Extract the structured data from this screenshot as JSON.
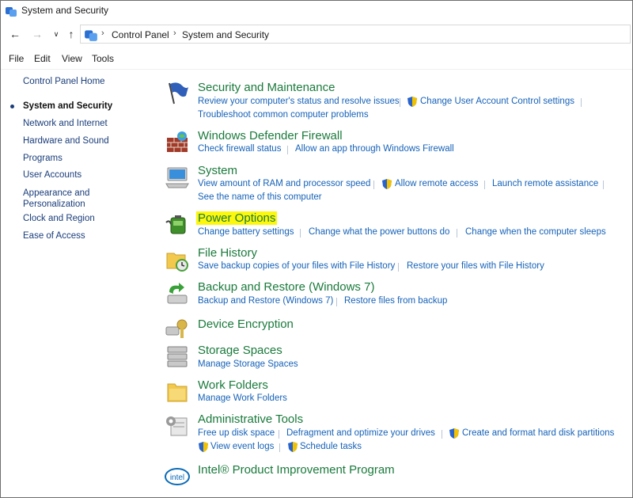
{
  "window": {
    "title": "System and Security"
  },
  "address": {
    "segments": [
      "Control Panel",
      "System and Security"
    ]
  },
  "menu": [
    "File",
    "Edit",
    "View",
    "Tools"
  ],
  "sidebar": {
    "home": "Control Panel Home",
    "items": [
      {
        "label": "System and Security",
        "current": true
      },
      {
        "label": "Network and Internet"
      },
      {
        "label": "Hardware and Sound"
      },
      {
        "label": "Programs"
      },
      {
        "label": "User Accounts"
      },
      {
        "label": "Appearance and Personalization"
      },
      {
        "label": "Clock and Region"
      },
      {
        "label": "Ease of Access"
      }
    ]
  },
  "categories": {
    "security": {
      "title": "Security and Maintenance",
      "icon": "flag-icon",
      "links": [
        "Review your computer's status and resolve issues",
        "Change User Account Control settings",
        "Troubleshoot common computer problems"
      ]
    },
    "firewall": {
      "title": "Windows Defender Firewall",
      "icon": "brick-wall-icon",
      "links": [
        "Check firewall status",
        "Allow an app through Windows Firewall"
      ]
    },
    "system": {
      "title": "System",
      "icon": "computer-icon",
      "links": [
        "View amount of RAM and processor speed",
        "Allow remote access",
        "Launch remote assistance",
        "See the name of this computer"
      ]
    },
    "power": {
      "title": "Power Options",
      "icon": "battery-icon",
      "highlighted": true,
      "links": [
        "Change battery settings",
        "Change what the power buttons do",
        "Change when the computer sleeps"
      ]
    },
    "filehistory": {
      "title": "File History",
      "icon": "folder-clock-icon",
      "links": [
        "Save backup copies of your files with File History",
        "Restore your files with File History"
      ]
    },
    "backup": {
      "title": "Backup and Restore (Windows 7)",
      "icon": "backup-icon",
      "links": [
        "Backup and Restore (Windows 7)",
        "Restore files from backup"
      ]
    },
    "encryption": {
      "title": "Device Encryption",
      "icon": "key-icon",
      "links": []
    },
    "storage": {
      "title": "Storage Spaces",
      "icon": "disks-icon",
      "links": [
        "Manage Storage Spaces"
      ]
    },
    "workfolders": {
      "title": "Work Folders",
      "icon": "folder-icon",
      "links": [
        "Manage Work Folders"
      ]
    },
    "admin": {
      "title": "Administrative Tools",
      "icon": "admin-tools-icon",
      "links": [
        "Free up disk space",
        "Defragment and optimize your drives",
        "Create and format hard disk partitions",
        "View event logs",
        "Schedule tasks"
      ]
    },
    "intel": {
      "title": "Intel® Product Improvement Program",
      "icon": "intel-icon",
      "links": []
    }
  },
  "colors": {
    "link": "#1662b8",
    "category": "#1a7a3c",
    "highlight": "#fcf70d"
  }
}
